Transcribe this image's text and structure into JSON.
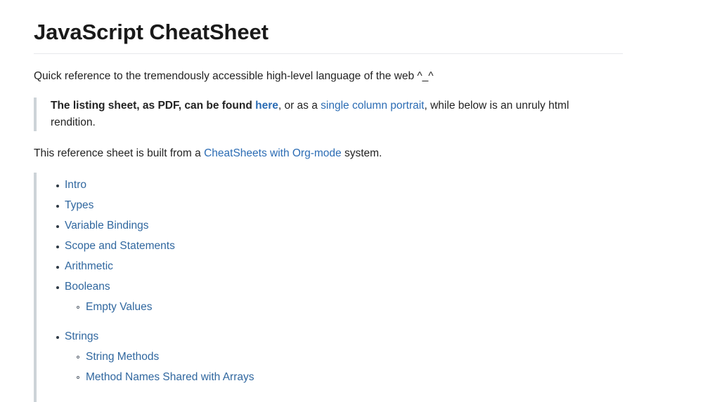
{
  "header": {
    "title": "JavaScript CheatSheet"
  },
  "intro": {
    "text": "Quick reference to the tremendously accessible high-level language of the web ^_^"
  },
  "blockquote": {
    "strong_prefix": "The listing sheet, as PDF, can be found ",
    "link_here": "here",
    "mid_text": ", or as a ",
    "link_portrait": "single column portrait",
    "tail_text": ", while below is an unruly html rendition."
  },
  "built_from": {
    "prefix": "This reference sheet is built from a ",
    "link": "CheatSheets with Org-mode",
    "suffix": " system."
  },
  "toc": {
    "items": [
      {
        "label": "Intro",
        "children": []
      },
      {
        "label": "Types",
        "children": []
      },
      {
        "label": "Variable Bindings",
        "children": []
      },
      {
        "label": "Scope and Statements",
        "children": []
      },
      {
        "label": "Arithmetic",
        "children": []
      },
      {
        "label": "Booleans",
        "children": [
          {
            "label": "Empty Values"
          }
        ]
      },
      {
        "label": "Strings",
        "children": [
          {
            "label": "String Methods"
          },
          {
            "label": "Method Names Shared with Arrays"
          }
        ]
      }
    ]
  },
  "colors": {
    "link": "#2b6cb4",
    "toc_link": "#30679f",
    "rule": "#e7e9eb",
    "quote_border": "#cdd3d8",
    "text": "#232323",
    "title": "#1a1a1a"
  }
}
